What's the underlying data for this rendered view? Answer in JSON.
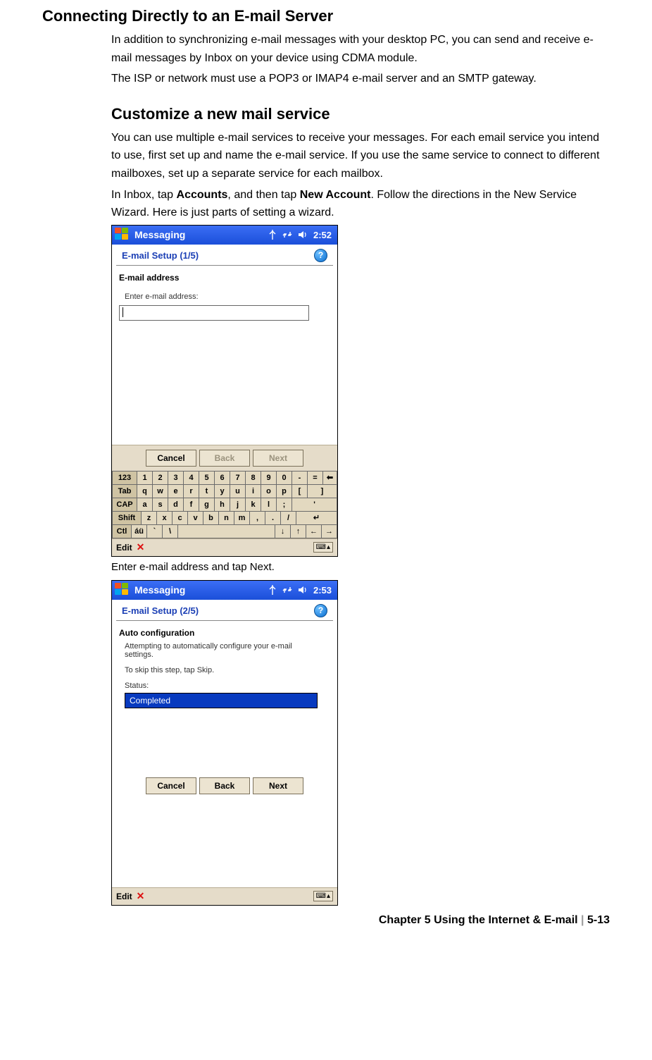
{
  "headings": {
    "h1": "Connecting Directly to an E-mail Server",
    "h2": "Customize a new mail service"
  },
  "para": {
    "p1": "In addition to synchronizing e-mail messages with your desktop PC, you can send and receive e-mail messages by Inbox on your device using CDMA module.",
    "p2": "The ISP or network must use a POP3 or IMAP4 e-mail server and an SMTP gateway.",
    "p3": "You can use multiple e-mail services to receive your messages. For each email service you intend to use, first set up and name the e-mail service. If you use the same service to connect to different mailboxes, set up a separate service for each mailbox.",
    "p4a": "In Inbox, tap ",
    "p4b": "Accounts",
    "p4c": ", and then tap ",
    "p4d": "New Account",
    "p4e": ". Follow the directions in the New Service Wizard. Here is just parts of setting a wizard."
  },
  "caption1": "Enter e-mail address and tap Next.",
  "shot1": {
    "titlebar": "Messaging",
    "time": "2:52",
    "subhead": "E-mail Setup (1/5)",
    "section": "E-mail address",
    "prompt": "Enter e-mail address:",
    "input_value": "",
    "buttons": {
      "cancel": "Cancel",
      "back": "Back",
      "next": "Next"
    },
    "edit": "Edit"
  },
  "shot2": {
    "titlebar": "Messaging",
    "time": "2:53",
    "subhead": "E-mail Setup (2/5)",
    "section": "Auto configuration",
    "line1": "Attempting to automatically configure your e-mail settings.",
    "line2": "To skip this step, tap Skip.",
    "status_label": "Status:",
    "status_value": "Completed",
    "buttons": {
      "cancel": "Cancel",
      "back": "Back",
      "next": "Next"
    },
    "edit": "Edit"
  },
  "kbd": {
    "row1": [
      "123",
      "1",
      "2",
      "3",
      "4",
      "5",
      "6",
      "7",
      "8",
      "9",
      "0",
      "-",
      "=",
      "⬅"
    ],
    "row2": [
      "Tab",
      "q",
      "w",
      "e",
      "r",
      "t",
      "y",
      "u",
      "i",
      "o",
      "p",
      "[",
      "]"
    ],
    "row3": [
      "CAP",
      "a",
      "s",
      "d",
      "f",
      "g",
      "h",
      "j",
      "k",
      "l",
      ";",
      "'"
    ],
    "row4": [
      "Shift",
      "z",
      "x",
      "c",
      "v",
      "b",
      "n",
      "m",
      ",",
      ".",
      "/",
      "↵"
    ],
    "row5": [
      "Ctl",
      "áü",
      "`",
      "\\",
      " ",
      "↓",
      "↑",
      "←",
      "→"
    ]
  },
  "footer": {
    "text": "Chapter 5 Using the Internet & E-mail",
    "page": "5-13"
  }
}
